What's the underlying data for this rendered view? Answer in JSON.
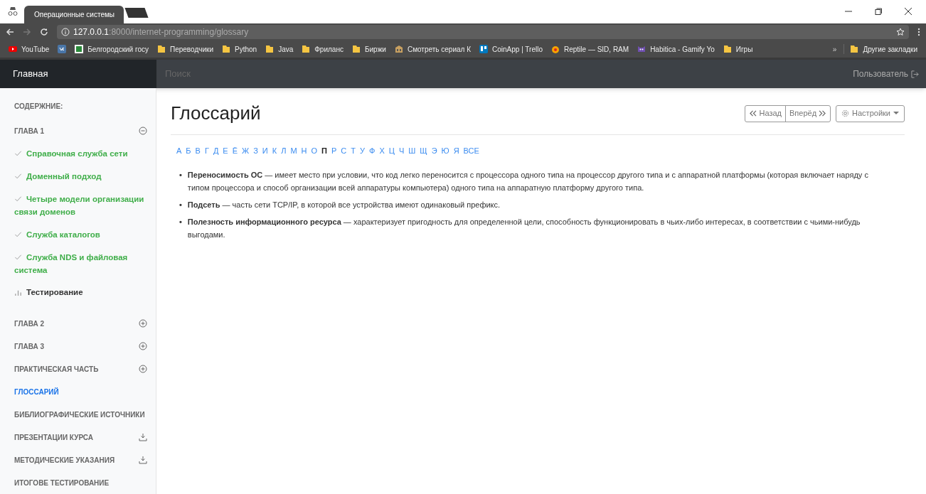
{
  "browser": {
    "tabs": [
      {
        "title": "Операционные системы",
        "selected": true
      }
    ],
    "address": {
      "host": "127.0.0.1",
      "path": ":8000/internet-programming/glossary"
    },
    "bookmarks": [
      {
        "kind": "youtube",
        "label": "YouTube"
      },
      {
        "kind": "vk"
      },
      {
        "kind": "site",
        "label": "Белгородский госу"
      },
      {
        "kind": "folder",
        "label": "Переводчики"
      },
      {
        "kind": "folder",
        "label": "Python"
      },
      {
        "kind": "folder",
        "label": "Java"
      },
      {
        "kind": "folder",
        "label": "Фриланс"
      },
      {
        "kind": "folder",
        "label": "Биржи"
      },
      {
        "kind": "building",
        "label": "Смотреть сериал К"
      },
      {
        "kind": "trello",
        "label": "CoinApp | Trello"
      },
      {
        "kind": "reptile",
        "label": "Reptile — SID, RAM"
      },
      {
        "kind": "habitica",
        "label": "Habitica - Gamify Yo"
      },
      {
        "kind": "folder",
        "label": "Игры"
      }
    ],
    "more": "»",
    "other_bookmarks": "Другие закладки"
  },
  "navbar": {
    "brand": "Главная",
    "search": {
      "placeholder": "Поиск"
    },
    "user": "Пользователь"
  },
  "sidebar": {
    "heading": "СОДЕРЖНИЕ:",
    "items": [
      {
        "kind": "chapter",
        "label": "ГЛАВА 1",
        "expanded": true,
        "selected": false
      },
      {
        "kind": "lesson",
        "label": "Справочная служба сети",
        "done": true
      },
      {
        "kind": "lesson",
        "label": "Доменный подход",
        "done": true
      },
      {
        "kind": "lesson",
        "label": "Четыре модели организации связи доменов",
        "done": true
      },
      {
        "kind": "lesson",
        "label": "Служба каталогов",
        "done": true
      },
      {
        "kind": "lesson",
        "label": "Служба NDS и файловая система",
        "done": true
      },
      {
        "kind": "test",
        "label": "Тестирование"
      },
      {
        "kind": "chapter",
        "label": "ГЛАВА 2",
        "expanded": false,
        "selected": false
      },
      {
        "kind": "chapter",
        "label": "ГЛАВА 3",
        "expanded": false,
        "selected": false
      },
      {
        "kind": "chapter",
        "label": "ПРАКТИЧЕСКАЯ ЧАСТЬ",
        "expanded": false,
        "selected": false
      },
      {
        "kind": "section",
        "label": "ГЛОССАРИЙ",
        "selected": true
      },
      {
        "kind": "section",
        "label": "БИБЛИОГРАФИЧЕСКИЕ ИСТОЧНИКИ",
        "selected": false
      },
      {
        "kind": "download",
        "label": "ПРЕЗЕНТАЦИИ КУРСА",
        "selected": false
      },
      {
        "kind": "download",
        "label": "МЕТОДИЧЕСКИЕ УКАЗАНИЯ",
        "selected": false
      },
      {
        "kind": "section",
        "label": "ИТОГОВЕ ТЕСТИРОВАНИЕ",
        "selected": false
      }
    ]
  },
  "page": {
    "title": "Глоссарий",
    "back": "Назад",
    "forward": "Вперёд",
    "settings": "Настройки",
    "letters": [
      {
        "label": "А",
        "selected": false
      },
      {
        "label": "Б",
        "selected": false
      },
      {
        "label": "В",
        "selected": false
      },
      {
        "label": "Г",
        "selected": false
      },
      {
        "label": "Д",
        "selected": false
      },
      {
        "label": "Е",
        "selected": false
      },
      {
        "label": "Ё",
        "selected": false
      },
      {
        "label": "Ж",
        "selected": false
      },
      {
        "label": "З",
        "selected": false
      },
      {
        "label": "И",
        "selected": false
      },
      {
        "label": "К",
        "selected": false
      },
      {
        "label": "Л",
        "selected": false
      },
      {
        "label": "М",
        "selected": false
      },
      {
        "label": "Н",
        "selected": false
      },
      {
        "label": "О",
        "selected": false
      },
      {
        "label": "П",
        "selected": true
      },
      {
        "label": "Р",
        "selected": false
      },
      {
        "label": "С",
        "selected": false
      },
      {
        "label": "Т",
        "selected": false
      },
      {
        "label": "У",
        "selected": false
      },
      {
        "label": "Ф",
        "selected": false
      },
      {
        "label": "Х",
        "selected": false
      },
      {
        "label": "Ц",
        "selected": false
      },
      {
        "label": "Ч",
        "selected": false
      },
      {
        "label": "Ш",
        "selected": false
      },
      {
        "label": "Щ",
        "selected": false
      },
      {
        "label": "Э",
        "selected": false
      },
      {
        "label": "Ю",
        "selected": false
      },
      {
        "label": "Я",
        "selected": false
      },
      {
        "label": "ВСЕ",
        "selected": false
      }
    ],
    "terms": [
      {
        "bullet": "•",
        "text": "**Переносимость ОС** — имеет место при условии, что код легко переносится с процессора одного типа на процессор другого типа и с аппаратной платформы (которая включает наряду с типом процессора и способ организации всей аппаратуры компьютера) одного типа на аппаратную платформу другого типа."
      },
      {
        "bullet": "•",
        "text": "**Подсеть** — часть сети TCP/IP, в которой все устройства имеют одинаковый префикс."
      },
      {
        "bullet": "•",
        "text": "**Полезность информационного ресурса** — характеризует пригодность для определенной цели, способность функционировать в чьих-либо интересах, в соответствии с чьими-нибудь выгодами."
      }
    ]
  }
}
